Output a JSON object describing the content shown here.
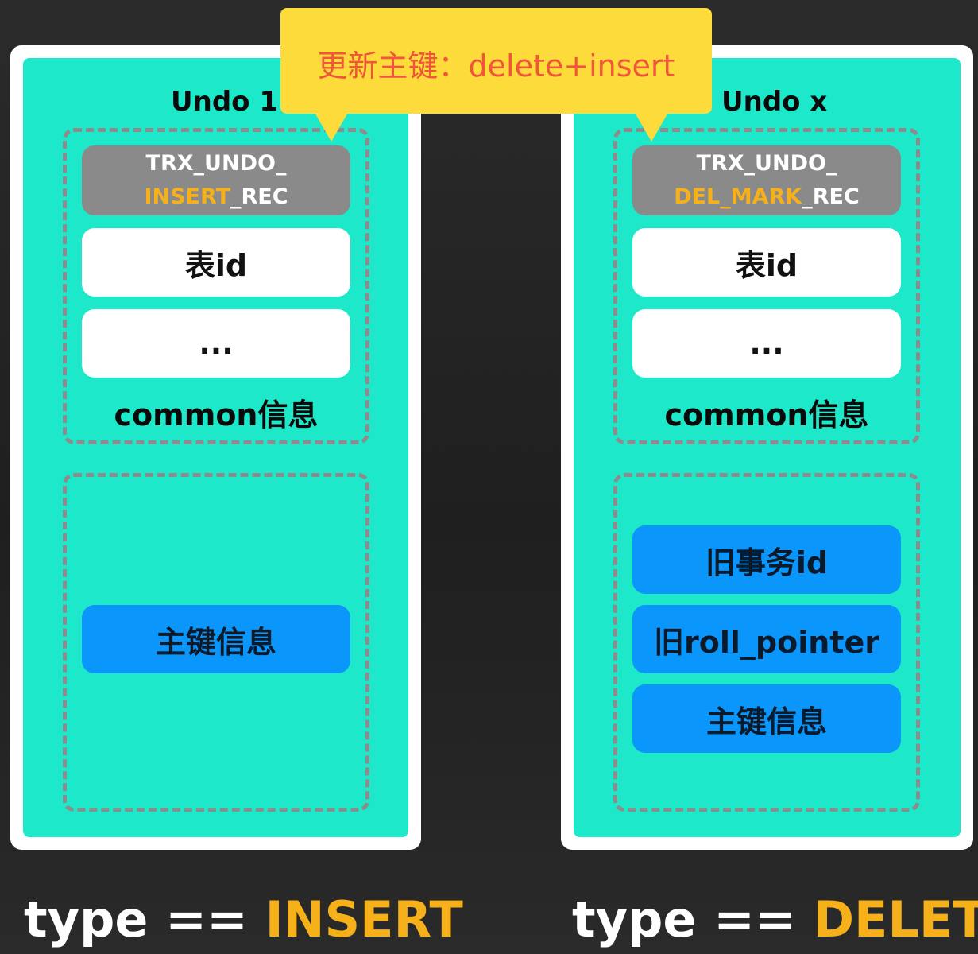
{
  "callout": {
    "text": "更新主键：delete+insert"
  },
  "left": {
    "title": "Undo 1",
    "record_type_line1": "TRX_UNDO_",
    "record_type_highlight": "INSERT",
    "record_type_suffix": "_REC",
    "field_table_id": "表id",
    "field_more": "...",
    "common_label": "common信息",
    "fields": [
      "主键信息"
    ],
    "type_prefix": "type == ",
    "type_value": "INSERT"
  },
  "right": {
    "title": "Undo x",
    "record_type_line1": "TRX_UNDO_",
    "record_type_highlight": "DEL_MARK",
    "record_type_suffix": "_REC",
    "field_table_id": "表id",
    "field_more": "...",
    "common_label": "common信息",
    "fields": [
      "旧事务id",
      "旧roll_pointer",
      "主键信息"
    ],
    "type_prefix": "type == ",
    "type_value": "DELETE"
  },
  "colors": {
    "panel": "#1de8c9",
    "highlight": "#f6b11a",
    "callout_bg": "#fddb3a",
    "callout_text": "#f0563a",
    "blue_field": "#0a96fb",
    "gray_header": "#8a8a8a"
  }
}
